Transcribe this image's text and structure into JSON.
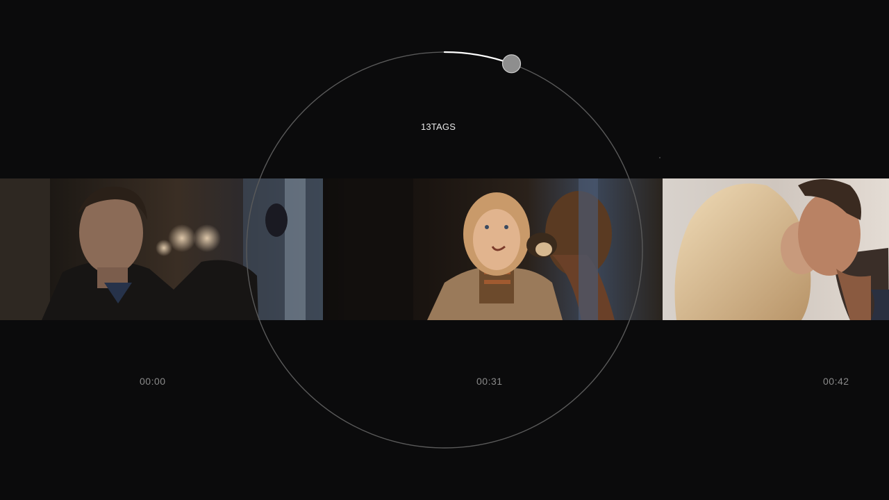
{
  "dial": {
    "tag_count": "13",
    "tag_unit": "TAGS",
    "progress": 0.055
  },
  "timeline": {
    "frames": [
      {
        "timestamp": "00:00",
        "scene": "man-dark-jacket"
      },
      {
        "timestamp": "00:31",
        "scene": "girl-with-monkey"
      },
      {
        "timestamp": "00:42",
        "scene": "couple-kissing"
      }
    ]
  },
  "colors": {
    "background": "#0b0b0c",
    "ring": "#5a5a5a",
    "progress": "#ffffff",
    "knob": "#9a9a9a",
    "timestamp": "#8a8a8a"
  }
}
